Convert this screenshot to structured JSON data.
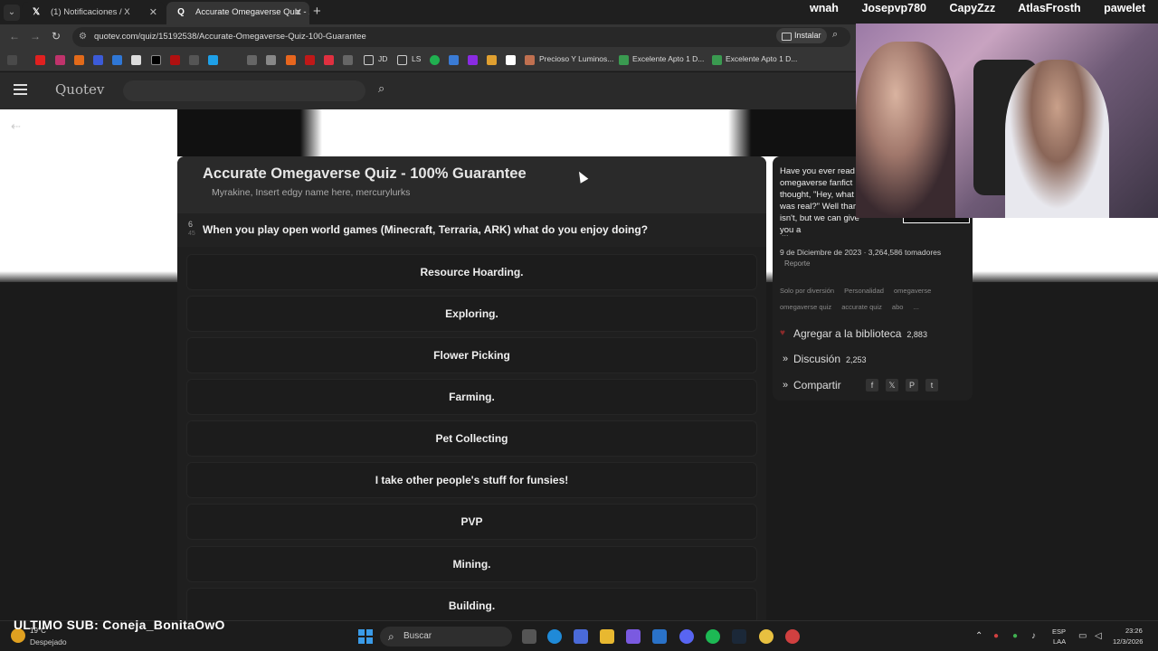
{
  "tabs": [
    {
      "title": "(1) Notificaciones / X",
      "icon": "x-icon",
      "active": false
    },
    {
      "title": "Accurate Omegaverse Quiz - 10",
      "icon": "quotev-icon",
      "active": true
    }
  ],
  "address": {
    "url": "quotev.com/quiz/15192538/Accurate-Omegaverse-Quiz-100-Guarantee",
    "install_label": "Instalar"
  },
  "bookmarks": [
    {
      "label": "JD"
    },
    {
      "label": "LS"
    },
    {
      "label": "Precioso Y Luminos..."
    },
    {
      "label": "Excelente Apto 1 D..."
    },
    {
      "label": "Excelente Apto 1 D..."
    }
  ],
  "site": {
    "logo": "Quotev"
  },
  "quiz": {
    "title": "Accurate Omegaverse Quiz - 100% Guarantee",
    "authors": "Myrakine, Insert edgy name here, mercurylurks",
    "question_number": "6",
    "question_total": "45",
    "question": "When you play open world games (Minecraft, Terraria, ARK) what do you enjoy doing?",
    "answers": [
      "Resource Hoarding.",
      "Exploring.",
      "Flower Picking",
      "Farming.",
      "Pet Collecting",
      "I take other people's stuff for funsies!",
      "PVP",
      "Mining.",
      "Building."
    ]
  },
  "sidebar": {
    "description": "Have you ever read omegaverse fanfict thought, \"Hey, what was real?\" Well thar isn't, but we can give you a",
    "more": "...",
    "date_line": "9 de Diciembre de 2023 · 3,264,586 tomadores",
    "report": "Reporte",
    "tags": [
      "Solo por diversión",
      "Personalidad",
      "omegaverse",
      "omegaverse quiz",
      "accurate quiz",
      "abo",
      "..."
    ],
    "library_label": "Agregar a la biblioteca",
    "library_count": "2,883",
    "discussion_label": "Discusión",
    "discussion_count": "2,253",
    "share_label": "Compartir"
  },
  "stream": {
    "names": [
      "wnah",
      "Josepvp780",
      "CapyZzz",
      "AtlasFrosth",
      "pawelet"
    ],
    "last_sub": "ULTIMO SUB: Coneja_BonitaOwO"
  },
  "taskbar": {
    "weather_temp": "19°C",
    "weather_text": "Despejado",
    "search_placeholder": "Buscar",
    "lang_1": "ESP",
    "lang_2": "LAA",
    "time": "23:26",
    "date": "12/3/2026"
  },
  "colors": {
    "accent_start": "#3a9be8",
    "heart": "#8b2a2a"
  }
}
